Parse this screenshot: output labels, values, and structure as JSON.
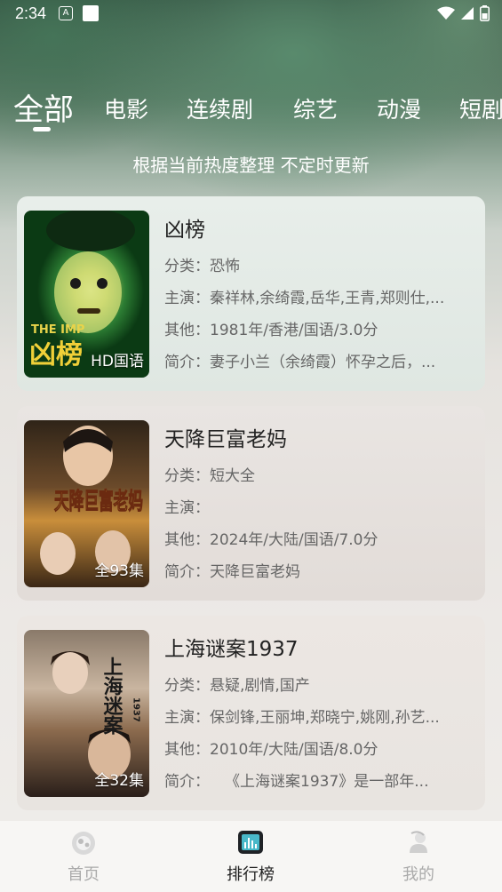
{
  "status_bar": {
    "time": "2:34",
    "notification_badge": "A"
  },
  "tabs": [
    {
      "label": "全部",
      "active": true
    },
    {
      "label": "电影",
      "active": false
    },
    {
      "label": "连续剧",
      "active": false
    },
    {
      "label": "综艺",
      "active": false
    },
    {
      "label": "动漫",
      "active": false
    },
    {
      "label": "短剧",
      "active": false
    }
  ],
  "subtitle": "根据当前热度整理 不定时更新",
  "cards": [
    {
      "title": "凶榜",
      "badge": "HD国语",
      "poster_text_en": "THE IMP",
      "poster_text_cn": "凶榜",
      "category_label": "分类：",
      "category": "恐怖",
      "cast_label": "主演：",
      "cast": "秦祥林,余绮霞,岳华,王青,郑则仕,...",
      "other_label": "其他：",
      "other": "1981年/香港/国语/3.0分",
      "intro_label": "简介：",
      "intro": "妻子小兰（余绮霞）怀孕之后，..."
    },
    {
      "title": "天降巨富老妈",
      "badge": "全93集",
      "poster_text_cn": "天降巨富老妈",
      "category_label": "分类：",
      "category": "短大全",
      "cast_label": "主演：",
      "cast": "",
      "other_label": "其他：",
      "other": "2024年/大陆/国语/7.0分",
      "intro_label": "简介：",
      "intro": "天降巨富老妈"
    },
    {
      "title": "上海谜案1937",
      "badge": "全32集",
      "poster_text_cn": "上海迷案",
      "poster_year": "1937",
      "category_label": "分类：",
      "category": "悬疑,剧情,国产",
      "cast_label": "主演：",
      "cast": "保剑锋,王丽坤,郑晓宁,姚刚,孙艺...",
      "other_label": "其他：",
      "other": "2010年/大陆/国语/8.0分",
      "intro_label": "简介：",
      "intro": "　　《上海谜案1937》是一部年..."
    }
  ],
  "bottom_nav": [
    {
      "label": "首页",
      "icon": "home-icon",
      "active": false
    },
    {
      "label": "排行榜",
      "icon": "ranking-icon",
      "active": true
    },
    {
      "label": "我的",
      "icon": "profile-icon",
      "active": false
    }
  ],
  "colors": {
    "accent_teal": "#49b8c9",
    "inactive": "#aaaaaa",
    "text_dark": "#222222"
  }
}
